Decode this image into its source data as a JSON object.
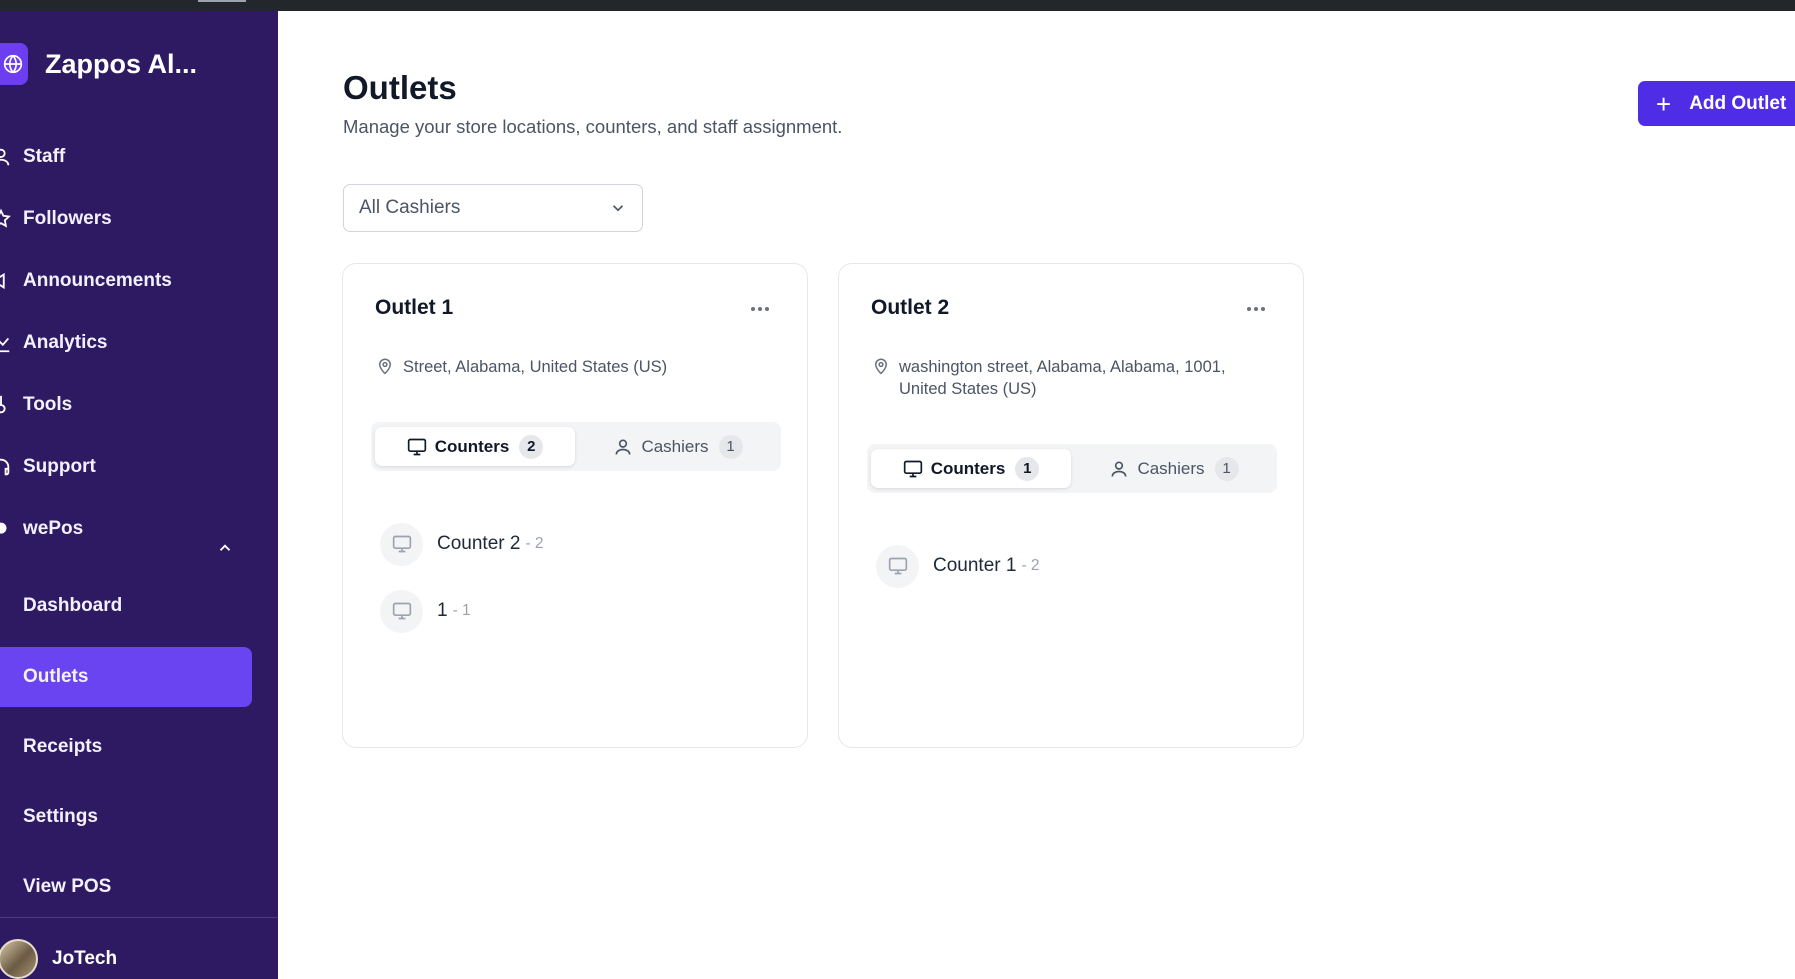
{
  "sidebar": {
    "brand": {
      "name": "Zappos Al...",
      "icon": "globe-icon"
    },
    "nav": [
      {
        "label": "Staff",
        "icon": "users-icon"
      },
      {
        "label": "Followers",
        "icon": "star-user-icon"
      },
      {
        "label": "Announcements",
        "icon": "megaphone-icon"
      },
      {
        "label": "Analytics",
        "icon": "chart-icon"
      },
      {
        "label": "Tools",
        "icon": "tools-icon"
      },
      {
        "label": "Support",
        "icon": "headset-icon"
      },
      {
        "label": "wePos",
        "icon": "dot-icon"
      }
    ],
    "sub_nav": [
      {
        "label": "Dashboard",
        "active": false
      },
      {
        "label": "Outlets",
        "active": true
      },
      {
        "label": "Receipts",
        "active": false
      },
      {
        "label": "Settings",
        "active": false
      },
      {
        "label": "View POS",
        "active": false
      }
    ],
    "user": {
      "name": "JoTech"
    }
  },
  "header": {
    "title": "Outlets",
    "subtitle": "Manage your store locations, counters, and staff assignment.",
    "add_button": "Add Outlet"
  },
  "filter": {
    "selected": "All Cashiers"
  },
  "outlets": [
    {
      "name": "Outlet 1",
      "address": "Street, Alabama, United States (US)",
      "tabs": {
        "counters_label": "Counters",
        "counters_count": "2",
        "cashiers_label": "Cashiers",
        "cashiers_count": "1"
      },
      "counters": [
        {
          "name": "Counter 2",
          "number": "- 2"
        },
        {
          "name": "1",
          "number": "- 1"
        }
      ]
    },
    {
      "name": "Outlet 2",
      "address": "washington street, Alabama, Alabama, 1001, United States (US)",
      "tabs": {
        "counters_label": "Counters",
        "counters_count": "1",
        "cashiers_label": "Cashiers",
        "cashiers_count": "1"
      },
      "counters": [
        {
          "name": "Counter 1",
          "number": "- 2"
        }
      ]
    }
  ],
  "colors": {
    "sidebar_bg": "#2e1a63",
    "accent": "#4f2de6",
    "active_nav": "#6a44f0"
  }
}
